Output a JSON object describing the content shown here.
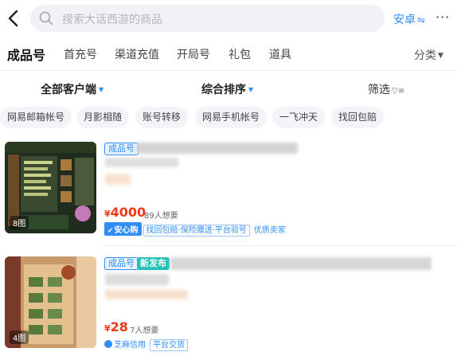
{
  "search": {
    "placeholder": "搜索大话西游的商品"
  },
  "header": {
    "platform": "安卓",
    "platform_switch_icon": "swap-icon",
    "more": "···"
  },
  "tabs": [
    {
      "label": "成品号",
      "active": true
    },
    {
      "label": "首充号"
    },
    {
      "label": "渠道充值"
    },
    {
      "label": "开局号"
    },
    {
      "label": "礼包"
    },
    {
      "label": "道具"
    }
  ],
  "classify": {
    "label": "分类"
  },
  "filters": {
    "client": "全部客户端",
    "sort": "综合排序",
    "screen": "筛选"
  },
  "chips": [
    "网易邮箱帐号",
    "月影相随",
    "账号转移",
    "网易手机帐号",
    "一飞冲天",
    "找回包赔"
  ],
  "listings": [
    {
      "image_count": "8图",
      "type_badge": "成品号",
      "price_symbol": "¥",
      "price": "4000",
      "wants": "89人想要",
      "safe_label": "安心购",
      "guarantee": "找回包赔·保险赠送·平台验号",
      "seller_tag": "优质卖家"
    },
    {
      "image_count": "4图",
      "type_badge": "成品号",
      "new_badge": "新发布",
      "price_symbol": "¥",
      "price": "28",
      "wants": "7人想要",
      "credit_label": "芝麻信用",
      "platform_ship": "平台交货"
    }
  ],
  "colors": {
    "accent": "#2f8df6",
    "price": "#f03a17",
    "new_badge": "#27c0b8"
  }
}
